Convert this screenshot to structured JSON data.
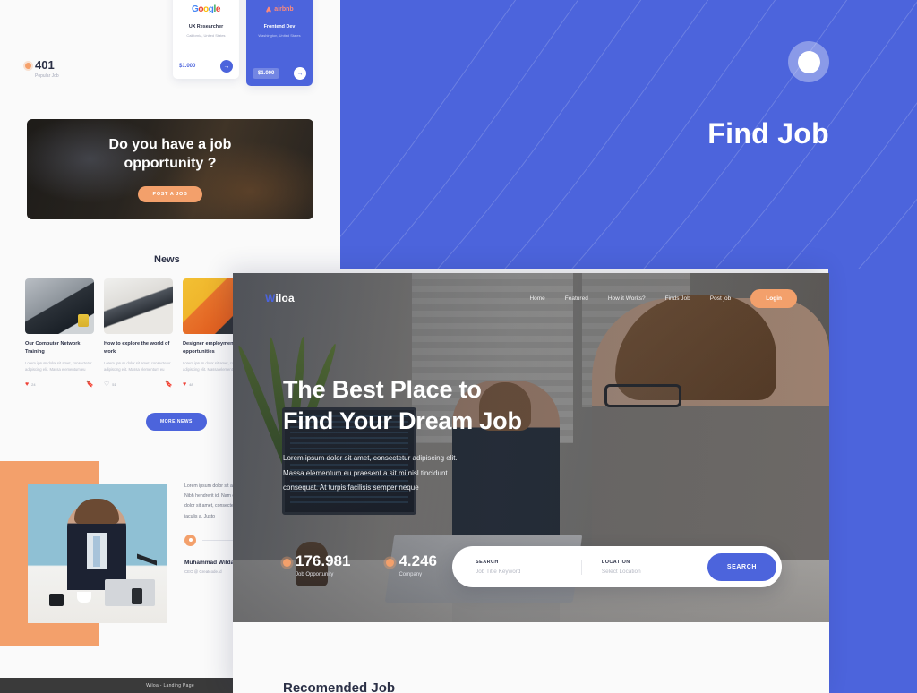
{
  "presentation": {
    "panel_title": "Find Job",
    "footer_caption": "Wiloa - Landing Page"
  },
  "job_cards": [
    {
      "company": "Google",
      "logo": "google-logo",
      "title": "UX Researcher",
      "location": "California, United States",
      "salary": "$1.000",
      "arrow": "→"
    },
    {
      "company": "airbnb",
      "logo": "airbnb-logo",
      "title": "Frontend Dev",
      "location": "Washington, United States",
      "salary": "$1.000",
      "arrow": "→"
    }
  ],
  "popular_stat": {
    "value": "401",
    "label": "Popular Job"
  },
  "cta_banner": {
    "title_line1": "Do you have a job",
    "title_line2": "opportunity ?",
    "button_label": "POST A JOB"
  },
  "news": {
    "heading": "News",
    "more_button": "MORE NEWS",
    "cards": [
      {
        "title": "Our Computer Network Training",
        "excerpt": "Lorem ipsum dolor sit amet, consectetur adipiscing elit. Massa elementum eu",
        "likes": "24",
        "liked": true,
        "like_icon": "heart-filled-icon",
        "bookmark_icon": "bookmark-icon"
      },
      {
        "title": "How to explore the world of work",
        "excerpt": "Lorem ipsum dolor sit amet, consectetur adipiscing elit. Massa elementum eu",
        "likes": "51",
        "liked": false,
        "like_icon": "heart-outline-icon",
        "bookmark_icon": "bookmark-icon"
      },
      {
        "title": "Designer employment opportunities",
        "excerpt": "Lorem ipsum dolor sit amet, consectetur adipiscing elit. Massa elementum eu",
        "likes": "48",
        "liked": true,
        "like_icon": "heart-filled-icon",
        "bookmark_icon": "bookmark-icon"
      }
    ]
  },
  "testimonial": {
    "quote": "Lorem ipsum dolor sit amet, consectetur adipiscing elit. Nibh hendrerit id. Nam dictum orci id lorem. Lorem ipsum dolor sit amet, consectetur. Nibh hendrerit id nunc orci iaculis a. Justo",
    "name": "Muhammad Wildan",
    "role": "CEO @ Greatcode.id"
  },
  "mockup": {
    "logo": "Wiloa",
    "logo_first_letter": "W",
    "logo_rest": "iloa",
    "nav": [
      {
        "label": "Home"
      },
      {
        "label": "Featured"
      },
      {
        "label": "How it Works?"
      },
      {
        "label": "Finds Job"
      },
      {
        "label": "Post job"
      }
    ],
    "login_label": "Login",
    "hero": {
      "title_line1": "The Best Place to",
      "title_line2": "Find Your Dream Job",
      "paragraph_line1": "Lorem ipsum dolor sit amet, consectetur adipiscing elit.",
      "paragraph_line2": "Massa elementum eu praesent a sit mi nisl tincidunt",
      "paragraph_line3": "consequat. At turpis facilisis semper neque"
    },
    "stats": [
      {
        "value": "176.981",
        "label": "Job Opportunity"
      },
      {
        "value": "4.246",
        "label": "Company"
      }
    ],
    "search": {
      "search_label": "SEARCH",
      "search_placeholder": "Job Title Keyword",
      "location_label": "LOCATION",
      "location_placeholder": "Select Location",
      "button_label": "SEARCH"
    },
    "recommended_heading": "Recomended Job"
  },
  "colors": {
    "brand_blue": "#4c64dc",
    "accent_orange": "#f3a06b",
    "heart_red": "#ef4136",
    "canvas": "#fafafa"
  }
}
